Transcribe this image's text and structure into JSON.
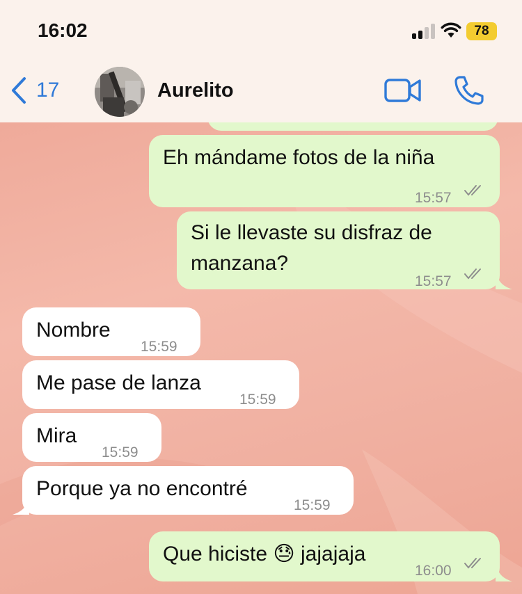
{
  "status_bar": {
    "time": "16:02",
    "battery": "78"
  },
  "header": {
    "back_count": "17",
    "contact_name": "Aurelito"
  },
  "messages": [
    {
      "direction": "out",
      "text": "Eh mándame fotos de la niña",
      "time": "15:57",
      "read": true
    },
    {
      "direction": "out",
      "text_line1": "Si le llevaste su disfraz de",
      "text_line2": "manzana?",
      "time": "15:57",
      "read": true
    },
    {
      "direction": "in",
      "text": "Nombre",
      "time": "15:59"
    },
    {
      "direction": "in",
      "text": "Me pase de lanza",
      "time": "15:59"
    },
    {
      "direction": "in",
      "text": "Mira",
      "time": "15:59"
    },
    {
      "direction": "in",
      "text": "Porque ya no encontré",
      "time": "15:59"
    },
    {
      "direction": "out",
      "text": "Que hiciste 😓 jajajaja",
      "time": "16:00",
      "read": true
    }
  ],
  "icons": {
    "back": "chevron-left-icon",
    "video": "video-camera-icon",
    "call": "phone-icon",
    "signal": "cellular-signal-icon",
    "wifi": "wifi-icon",
    "read": "double-check-icon"
  },
  "colors": {
    "accent": "#2f7ad8",
    "outgoing_bubble": "#e2f8cc",
    "incoming_bubble": "#ffffff",
    "chat_background": "#f2b5a6",
    "battery": "#f3cc30"
  }
}
